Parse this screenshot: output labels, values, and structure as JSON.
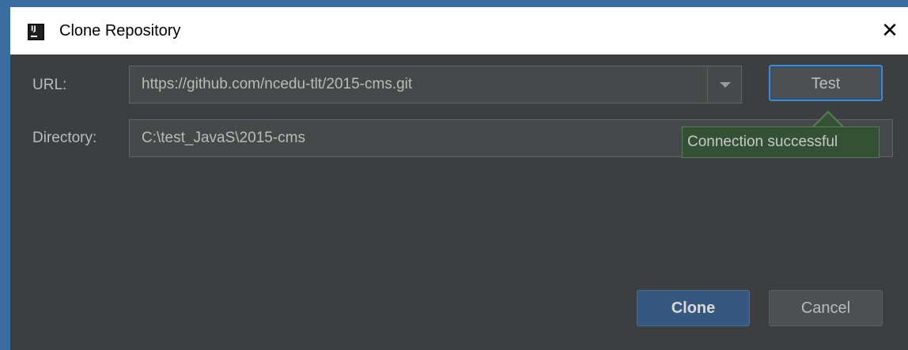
{
  "window": {
    "title": "Clone Repository",
    "close_glyph": "✕",
    "app_icon_text": "IJ"
  },
  "form": {
    "url_label": "URL:",
    "url_value": "https://github.com/ncedu-tlt/2015-cms.git",
    "directory_label": "Directory:",
    "directory_value": "C:\\test_JavaS\\2015-cms"
  },
  "buttons": {
    "test": "Test",
    "clone": "Clone",
    "cancel": "Cancel"
  },
  "tooltip": {
    "text": "Connection successful"
  },
  "icons": {
    "app": "intellij-icon",
    "close": "close-icon",
    "dropdown": "chevron-down-icon"
  },
  "colors": {
    "dialog_bg": "#3c3f41",
    "accent": "#4a87c4",
    "primary_button": "#365880",
    "tooltip_bg": "#355135"
  }
}
